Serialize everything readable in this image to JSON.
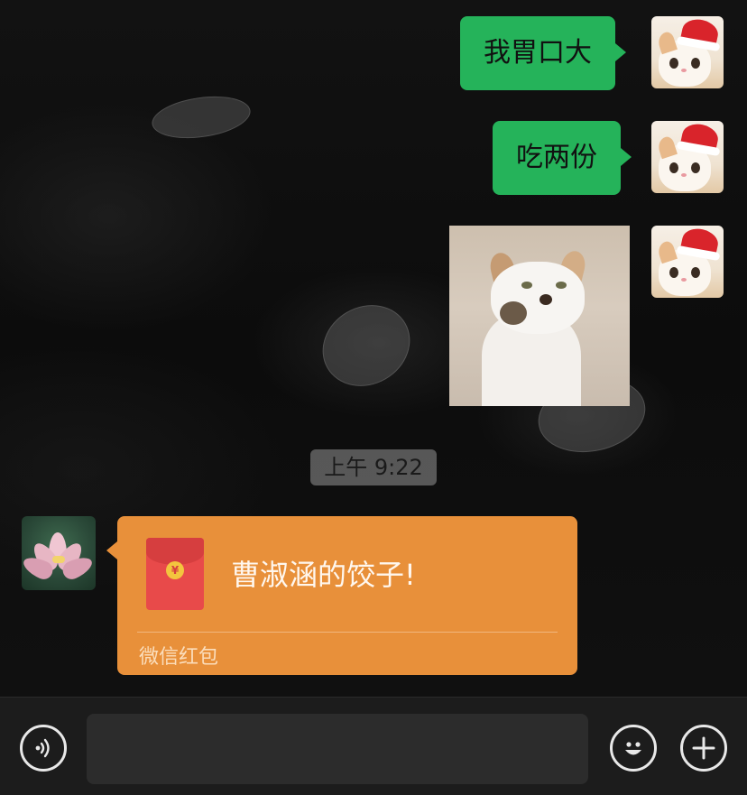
{
  "messages": [
    {
      "side": "right",
      "type": "text",
      "text": "我胃口大"
    },
    {
      "side": "right",
      "type": "text",
      "text": "吃两份"
    },
    {
      "side": "right",
      "type": "image",
      "alt": ""
    },
    {
      "type": "timestamp",
      "text": "上午 9:22"
    },
    {
      "side": "left",
      "type": "red_packet",
      "title": "曹淑涵的饺子!",
      "footer": "微信红包",
      "coin_symbol": "¥"
    }
  ],
  "colors": {
    "outgoing_bubble": "#25b35a",
    "red_packet": "#e8903a",
    "input_bar": "#1c1c1c"
  },
  "input": {
    "value": "",
    "placeholder": ""
  },
  "icons": {
    "voice": "voice-icon",
    "emoji": "emoji-icon",
    "plus": "plus-icon"
  }
}
